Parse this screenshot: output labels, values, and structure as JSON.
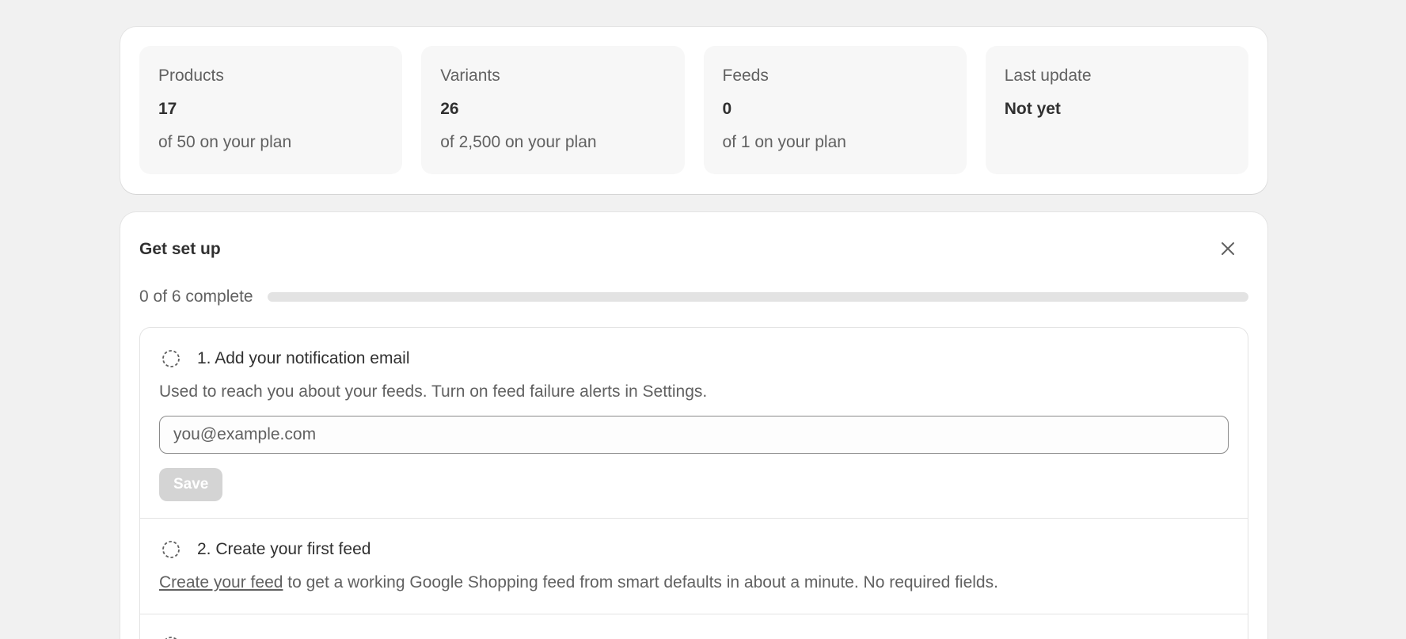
{
  "stats": [
    {
      "label": "Products",
      "value": "17",
      "sub": "of 50 on your plan"
    },
    {
      "label": "Variants",
      "value": "26",
      "sub": "of 2,500 on your plan"
    },
    {
      "label": "Feeds",
      "value": "0",
      "sub": "of 1 on your plan"
    },
    {
      "label": "Last update",
      "value": "Not yet",
      "sub": ""
    }
  ],
  "setup": {
    "title": "Get set up",
    "progress_text": "0 of 6 complete",
    "progress_fraction": 0,
    "steps": [
      {
        "title": "1. Add your notification email",
        "description": "Used to reach you about your feeds. Turn on feed failure alerts in Settings.",
        "input_placeholder": "you@example.com",
        "input_value": "",
        "button_label": "Save"
      },
      {
        "title": "2. Create your first feed",
        "link_text": "Create your feed",
        "description_rest": " to get a working Google Shopping feed from smart defaults in about a minute. No required fields."
      }
    ]
  },
  "icons": {
    "close": "close-icon",
    "step_incomplete": "dashed-circle-icon"
  },
  "colors": {
    "background": "#f1f1f1",
    "card": "#ffffff",
    "stat_tile": "#f7f7f7",
    "progress_track": "#e3e3e3",
    "disabled_button": "#d4d4d4"
  }
}
